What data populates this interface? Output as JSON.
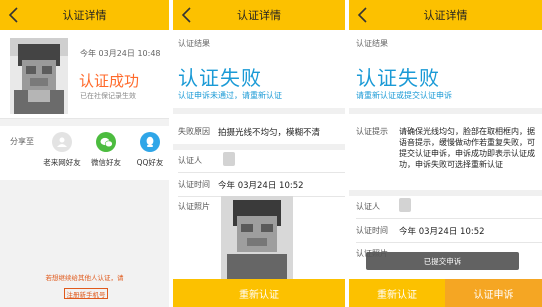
{
  "colors": {
    "header": "#fcc100",
    "success": "#ff6a2b",
    "fail": "#1a9ad6",
    "bottom_left": "#fcc100",
    "bottom_right": "#f5a623"
  },
  "screen1": {
    "title": "认证详情",
    "time": "今年 03月24日 10:48",
    "status": "认证成功",
    "note": "已在社保记录生效",
    "share_label": "分享至",
    "share_items": [
      {
        "label": "老来网好友",
        "icon": "laolai-icon"
      },
      {
        "label": "微信好友",
        "icon": "wechat-icon"
      },
      {
        "label": "QQ好友",
        "icon": "qq-icon"
      }
    ],
    "hint": "若想继续给其他人认证，请",
    "link": "注册新手机号"
  },
  "screen2": {
    "title": "认证详情",
    "result_label": "认证结果",
    "status": "认证失败",
    "sub": "认证申诉未通过，请重新认证",
    "reason_label": "失败原因",
    "reason": "拍摄光线不均匀，模糊不清",
    "person_label": "认证人",
    "time_label": "认证时间",
    "time": "今年 03月24日 10:52",
    "photo_label": "认证照片",
    "retry": "重新认证"
  },
  "screen3": {
    "title": "认证详情",
    "result_label": "认证结果",
    "status": "认证失败",
    "sub": "请重新认证或提交认证申诉",
    "tip_label": "认证提示",
    "tip": "请确保光线均匀，脸部在取相框内，据语音提示，缓慢做动作若重复失败，可提交认证申诉，申诉成功即表示认证成功，申诉失败可选择重新认证",
    "person_label": "认证人",
    "time_label": "认证时间",
    "time": "今年 03月24日 10:52",
    "photo_label": "认证照片",
    "toast": "已提交申诉",
    "retry": "重新认证",
    "appeal": "认证申诉"
  }
}
